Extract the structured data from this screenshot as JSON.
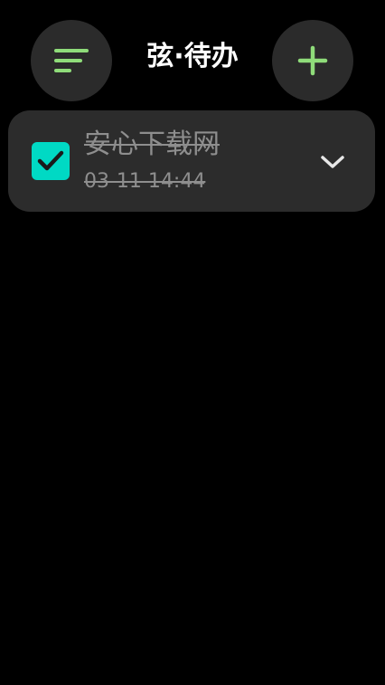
{
  "header": {
    "title": "弦·待办",
    "menu_icon": "sort-lines-icon",
    "add_icon": "plus-icon"
  },
  "todos": [
    {
      "title": "安心下载网",
      "time": "03-11 14:44",
      "completed": true,
      "expand_icon": "chevron-down-icon"
    }
  ],
  "colors": {
    "background": "#000000",
    "button_bg": "#2b2b2b",
    "card_bg": "#2c2c2c",
    "accent_green": "#8fdc7a",
    "checkbox_teal": "#00d9c4",
    "muted_text": "#8e8e8e",
    "title_text": "#ffffff"
  }
}
